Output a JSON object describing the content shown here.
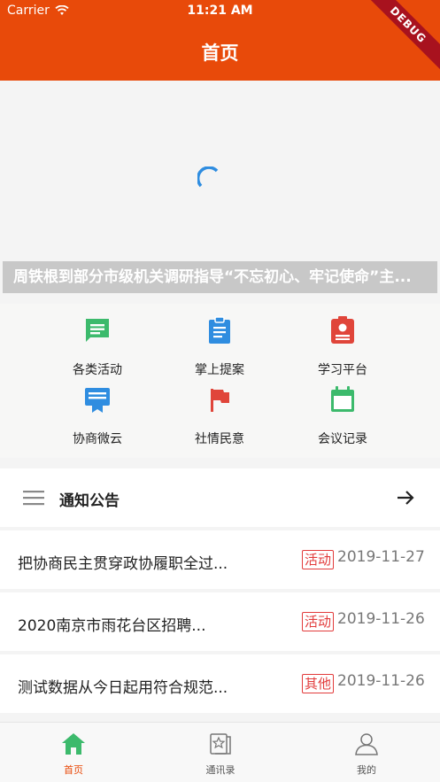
{
  "status_bar": {
    "carrier": "Carrier",
    "time": "11:21 AM"
  },
  "header": {
    "title": "首页",
    "debug_badge": "DEBUG"
  },
  "banner": {
    "caption": "周铁根到部分市级机关调研指导“不忘初心、牢记使命”主..."
  },
  "grid": {
    "items": [
      {
        "label": "各类活动",
        "icon": "chat-bubble-icon",
        "color": "#3cba6c"
      },
      {
        "label": "掌上提案",
        "icon": "clipboard-icon",
        "color": "#2f8de0"
      },
      {
        "label": "学习平台",
        "icon": "id-card-icon",
        "color": "#e0453a"
      },
      {
        "label": "协商微云",
        "icon": "tv-badge-icon",
        "color": "#2f8de0"
      },
      {
        "label": "社情民意",
        "icon": "flag-icon",
        "color": "#e0453a"
      },
      {
        "label": "会议记录",
        "icon": "calendar-icon",
        "color": "#3cba6c"
      }
    ]
  },
  "notice": {
    "title": "通知公告",
    "items": [
      {
        "title": "把协商民主贯穿政协履职全过...",
        "tag": "活动",
        "date": "2019-11-27"
      },
      {
        "title": "2020南京市雨花台区招聘...",
        "tag": "活动",
        "date": "2019-11-26"
      },
      {
        "title": "测试数据从今日起用符合规范...",
        "tag": "其他",
        "date": "2019-11-26"
      }
    ]
  },
  "tabbar": {
    "tabs": [
      {
        "label": "首页",
        "icon": "home-icon",
        "active": true
      },
      {
        "label": "通讯录",
        "icon": "contacts-icon",
        "active": false
      },
      {
        "label": "我的",
        "icon": "user-icon",
        "active": false
      }
    ]
  },
  "colors": {
    "accent": "#e84a0a",
    "tag_red": "#e23b3b"
  }
}
